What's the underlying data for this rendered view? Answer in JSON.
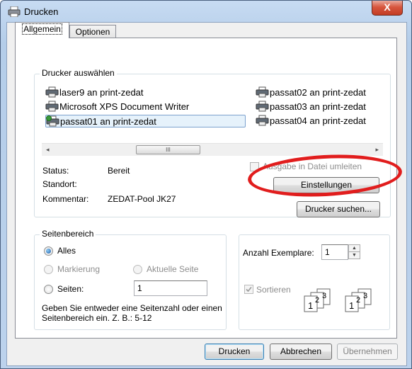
{
  "window": {
    "title": "Drucken",
    "close_glyph": "X"
  },
  "tabs": [
    {
      "label": "Allgemein"
    },
    {
      "label": "Optionen"
    }
  ],
  "printer_group": {
    "title": "Drucker auswählen",
    "printers_col1": [
      "laser9 an print-zedat",
      "Microsoft XPS Document Writer",
      "passat01 an print-zedat"
    ],
    "printers_col2": [
      "passat02 an print-zedat",
      "passat03 an print-zedat",
      "passat04 an print-zedat"
    ],
    "selected": "passat01 an print-zedat",
    "scroll_left": "◂",
    "scroll_right": "▸",
    "scroll_thumb": "III",
    "status_label": "Status:",
    "status_value": "Bereit",
    "location_label": "Standort:",
    "location_value": "",
    "comment_label": "Kommentar:",
    "comment_value": "ZEDAT-Pool JK27",
    "print_to_file_label": "Ausgabe in Datei umleiten",
    "settings_button": "Einstellungen",
    "find_printer_button": "Drucker suchen..."
  },
  "range_group": {
    "title": "Seitenbereich",
    "all": "Alles",
    "selection": "Markierung",
    "current_page": "Aktuelle Seite",
    "pages": "Seiten:",
    "pages_value": "1",
    "hint": "Geben Sie entweder eine Seitenzahl oder einen Seitenbereich ein. Z. B.: 5-12"
  },
  "copies_group": {
    "copies_label": "Anzahl Exemplare:",
    "copies_value": "1",
    "collate_label": "Sortieren",
    "collate_set1": [
      "1",
      "2",
      "3"
    ],
    "collate_set2": [
      "1",
      "2",
      "3"
    ]
  },
  "footer": {
    "print": "Drucken",
    "cancel": "Abbrechen",
    "apply": "Übernehmen"
  },
  "annotation_color": "#e11d1d"
}
